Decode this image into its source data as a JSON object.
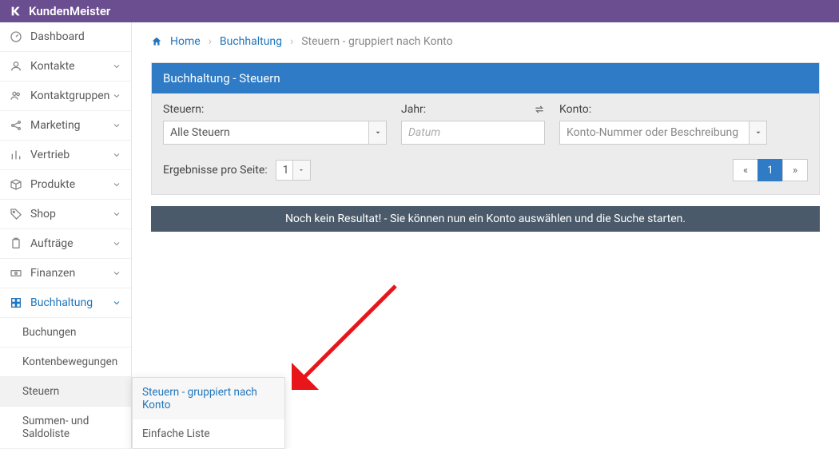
{
  "brand": "KundenMeister",
  "sidebar": {
    "items": [
      {
        "label": "Dashboard",
        "icon": "gauge"
      },
      {
        "label": "Kontakte",
        "icon": "user",
        "expandable": true
      },
      {
        "label": "Kontaktgruppen",
        "icon": "users",
        "expandable": true
      },
      {
        "label": "Marketing",
        "icon": "share",
        "expandable": true
      },
      {
        "label": "Vertrieb",
        "icon": "bars",
        "expandable": true
      },
      {
        "label": "Produkte",
        "icon": "box",
        "expandable": true
      },
      {
        "label": "Shop",
        "icon": "tag",
        "expandable": true
      },
      {
        "label": "Aufträge",
        "icon": "clipboard",
        "expandable": true
      },
      {
        "label": "Finanzen",
        "icon": "money",
        "expandable": true
      },
      {
        "label": "Buchhaltung",
        "icon": "grid",
        "expandable": true,
        "active": true
      }
    ],
    "buchhaltung_sub": [
      {
        "label": "Buchungen"
      },
      {
        "label": "Kontenbewegungen"
      },
      {
        "label": "Steuern",
        "active": true
      },
      {
        "label": "Summen- und Saldoliste"
      }
    ],
    "steuern_flyout": [
      {
        "label": "Steuern - gruppiert nach Konto",
        "active": true
      },
      {
        "label": "Einfache Liste"
      }
    ]
  },
  "breadcrumb": {
    "home": "Home",
    "second": "Buchhaltung",
    "third": "Steuern - gruppiert nach Konto"
  },
  "panel": {
    "title": "Buchhaltung - Steuern",
    "filters": {
      "steuern_label": "Steuern:",
      "steuern_value": "Alle Steuern",
      "jahr_label": "Jahr:",
      "jahr_placeholder": "Datum",
      "konto_label": "Konto:",
      "konto_placeholder": "Konto-Nummer oder Beschreibung"
    },
    "results_per_page_label": "Ergebnisse pro Seite:",
    "results_per_page_value": "1",
    "pager": {
      "prev": "«",
      "page": "1",
      "next": "»"
    },
    "status": "Noch kein Resultat! - Sie können nun ein Konto auswählen und die Suche starten."
  }
}
